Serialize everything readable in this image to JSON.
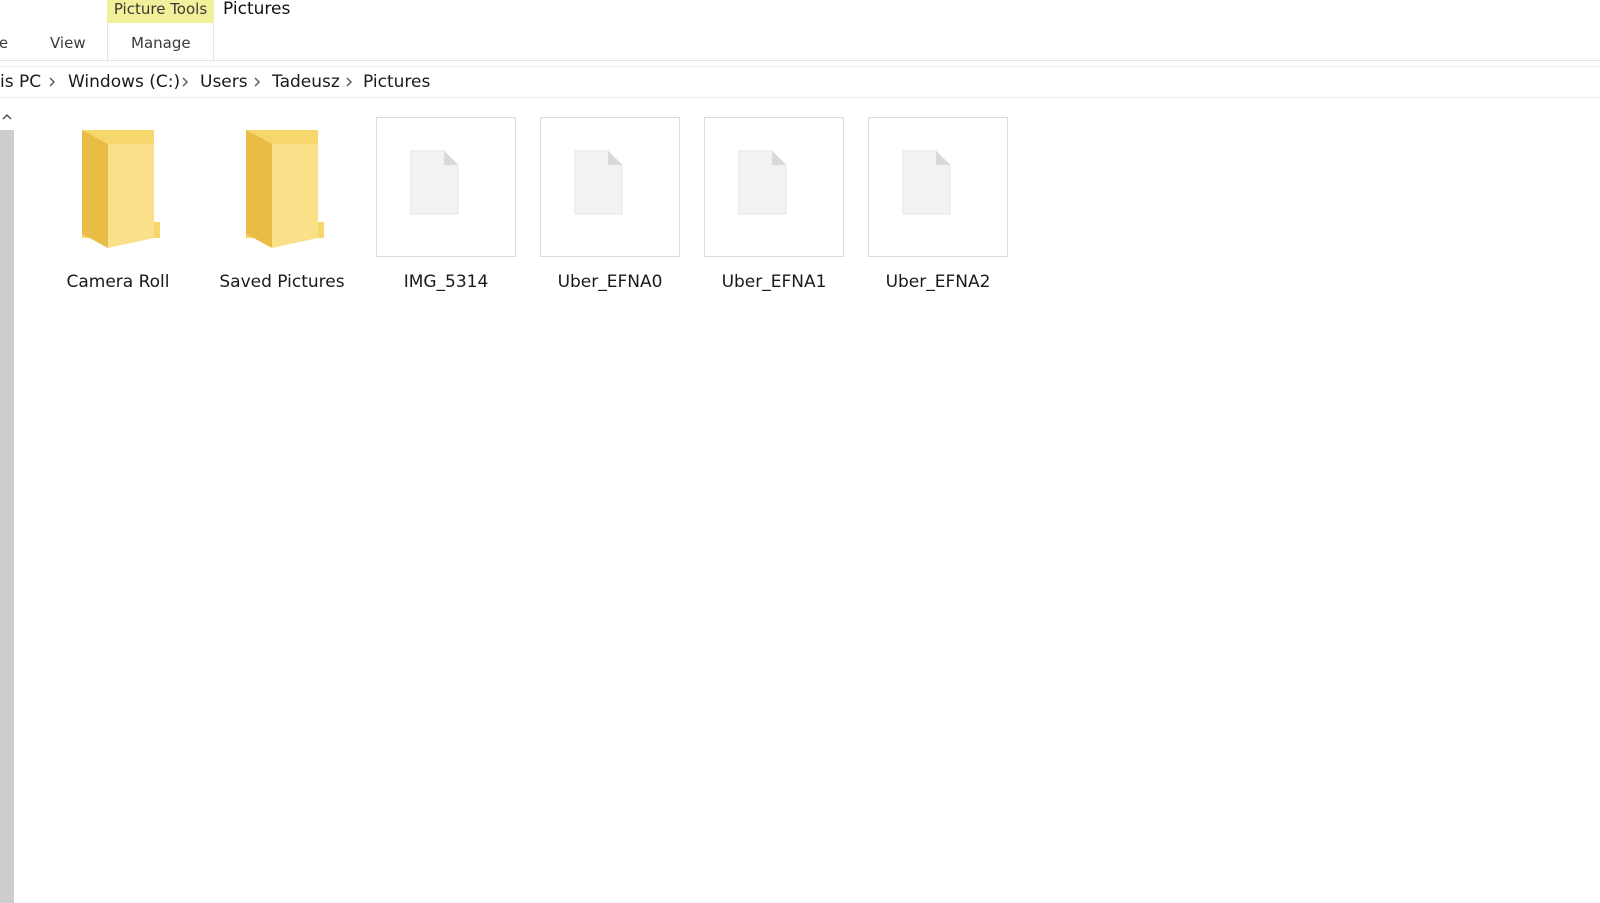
{
  "window": {
    "title": "Pictures",
    "context_tab": "Picture Tools"
  },
  "ribbon": {
    "tabs": [
      {
        "label": "re"
      },
      {
        "label": "View"
      },
      {
        "label": "Manage"
      }
    ]
  },
  "breadcrumb": {
    "items": [
      {
        "label": "is PC"
      },
      {
        "label": "Windows (C:)"
      },
      {
        "label": "Users"
      },
      {
        "label": "Tadeusz"
      },
      {
        "label": "Pictures"
      }
    ]
  },
  "files": [
    {
      "name": "Camera Roll",
      "type": "folder",
      "icon": "folder-icon"
    },
    {
      "name": "Saved Pictures",
      "type": "folder",
      "icon": "folder-icon"
    },
    {
      "name": "IMG_5314",
      "type": "file",
      "icon": "file-icon"
    },
    {
      "name": "Uber_EFNA0",
      "type": "file",
      "icon": "file-icon"
    },
    {
      "name": "Uber_EFNA1",
      "type": "file",
      "icon": "file-icon"
    },
    {
      "name": "Uber_EFNA2",
      "type": "file",
      "icon": "file-icon"
    }
  ],
  "colors": {
    "context_tab_bg": "#f2f09a",
    "folder_yellow": "#f7d66b",
    "scrollbar": "#cdcdcd"
  }
}
